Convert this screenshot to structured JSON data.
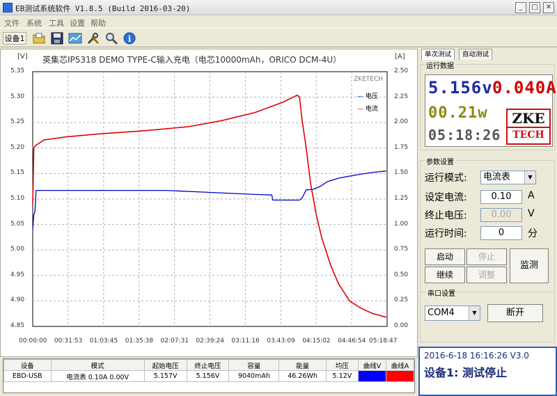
{
  "window": {
    "title": "EB测试系统软件  V1.8.5 (Build 2016-03-20)"
  },
  "menu": [
    "文件",
    "系统",
    "工具",
    "设置",
    "帮助"
  ],
  "toolbar": {
    "device_label": "设备1"
  },
  "chart_data": {
    "type": "line",
    "title": "英集芯IP5318 DEMO TYPE-C输入充电（电芯10000mAh，ORICO DCM-4U）",
    "xlabel": "",
    "ylabel_left": "[V]",
    "ylabel_right": "[A]",
    "watermark": "ZKETECH",
    "x_ticks": [
      "00:00:00",
      "00:31:53",
      "01:03:45",
      "01:35:38",
      "02:07:31",
      "02:39:24",
      "03:11:16",
      "03:43:09",
      "04:15:02",
      "04:46:54",
      "05:18:47"
    ],
    "y_left_ticks": [
      "5.35",
      "5.30",
      "5.25",
      "5.20",
      "5.15",
      "5.10",
      "5.05",
      "5.00",
      "4.95",
      "4.90",
      "4.85"
    ],
    "y_right_ticks": [
      "2.50",
      "2.25",
      "2.00",
      "1.75",
      "1.50",
      "1.25",
      "1.00",
      "0.75",
      "0.50",
      "0.25",
      "0.00"
    ],
    "ylim_left": [
      4.85,
      5.35
    ],
    "ylim_right": [
      0.0,
      2.5
    ],
    "xlim_minutes": [
      0,
      318.8
    ],
    "grid": true,
    "legend_position": "top-right",
    "series": [
      {
        "name": "电压",
        "axis": "left",
        "color": "#0000c8",
        "points": [
          [
            0,
            5.04
          ],
          [
            1,
            5.07
          ],
          [
            2,
            5.075
          ],
          [
            3,
            5.117
          ],
          [
            60,
            5.117
          ],
          [
            120,
            5.117
          ],
          [
            160,
            5.113
          ],
          [
            200,
            5.109
          ],
          [
            215,
            5.108
          ],
          [
            216,
            5.098
          ],
          [
            240,
            5.098
          ],
          [
            242,
            5.101
          ],
          [
            246,
            5.118
          ],
          [
            252,
            5.119
          ],
          [
            258,
            5.124
          ],
          [
            265,
            5.134
          ],
          [
            275,
            5.141
          ],
          [
            290,
            5.147
          ],
          [
            305,
            5.152
          ],
          [
            318,
            5.155
          ]
        ]
      },
      {
        "name": "电流",
        "axis": "right",
        "color": "#e00000",
        "points": [
          [
            0,
            1.2
          ],
          [
            1,
            1.75
          ],
          [
            3,
            1.78
          ],
          [
            6,
            1.8
          ],
          [
            10,
            1.83
          ],
          [
            30,
            1.86
          ],
          [
            60,
            1.89
          ],
          [
            100,
            1.92
          ],
          [
            140,
            1.96
          ],
          [
            170,
            2.02
          ],
          [
            200,
            2.1
          ],
          [
            225,
            2.2
          ],
          [
            238,
            2.27
          ],
          [
            240,
            2.25
          ],
          [
            242,
            2.05
          ],
          [
            246,
            1.75
          ],
          [
            250,
            1.4
          ],
          [
            255,
            1.1
          ],
          [
            260,
            0.87
          ],
          [
            268,
            0.6
          ],
          [
            275,
            0.42
          ],
          [
            285,
            0.25
          ],
          [
            295,
            0.18
          ],
          [
            305,
            0.13
          ],
          [
            318,
            0.09
          ]
        ]
      }
    ]
  },
  "stats_table": {
    "headers": [
      "设备",
      "模式",
      "起始电压",
      "终止电压",
      "容量",
      "能量",
      "均压",
      "曲线V",
      "曲线A"
    ],
    "row": [
      "EBD-USB",
      "电流表  0.10A  0.00V",
      "5.157V",
      "5.156V",
      "9040mAh",
      "46.26Wh",
      "5.12V",
      "",
      ""
    ],
    "curve_colors": [
      "#0000ff",
      "#ff0000"
    ]
  },
  "tabs": [
    "单次测试",
    "自动测试"
  ],
  "run_data": {
    "group_title": "运行数据",
    "voltage": "5.156v",
    "current": "0.040A",
    "power": "00.21w",
    "time": "05:18:26",
    "logo_top": "ZKE",
    "logo_bottom": "TECH"
  },
  "params": {
    "group_title": "参数设置",
    "mode_label": "运行模式:",
    "mode_value": "电流表",
    "current_label": "设定电流:",
    "current_value": "0.10",
    "current_unit": "A",
    "cutoff_label": "终止电压:",
    "cutoff_value": "0.00",
    "cutoff_unit": "V",
    "time_label": "运行时间:",
    "time_value": "0",
    "time_unit": "分"
  },
  "buttons": {
    "start": "启动",
    "stop": "停止",
    "continue": "继续",
    "adjust": "调整",
    "monitor": "监测",
    "disconnect": "断开"
  },
  "serial": {
    "group_title": "串口设置",
    "port": "COM4"
  },
  "status": {
    "line1": "2016-6-18 16:16:26  V3.0",
    "line2": "设备1: 测试停止"
  }
}
